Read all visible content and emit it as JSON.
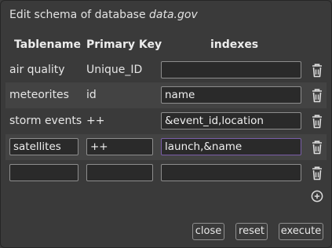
{
  "dialog": {
    "title_prefix": "Edit schema of database ",
    "database_name": "data.gov"
  },
  "columns": {
    "tablename": "Tablename",
    "primary_key": "Primary Key",
    "indexes": "indexes"
  },
  "rows": [
    {
      "tablename": "air quality",
      "primary_key": "Unique_ID",
      "indexes": ""
    },
    {
      "tablename": "meteorites",
      "primary_key": "id",
      "indexes": "name"
    },
    {
      "tablename": "storm events",
      "primary_key": "++",
      "indexes": "&event_id,location"
    },
    {
      "tablename": "satellites",
      "primary_key": "++",
      "indexes": "launch,&name"
    },
    {
      "tablename": "",
      "primary_key": "",
      "indexes": ""
    }
  ],
  "icons": {
    "delete": "trash-icon",
    "add": "plus-circle-icon"
  },
  "buttons": {
    "close": "close",
    "reset": "reset",
    "execute": "execute"
  },
  "colors": {
    "background": "#3a3a3a",
    "alt_row": "#434343",
    "focus_border": "#7a5ea8"
  }
}
